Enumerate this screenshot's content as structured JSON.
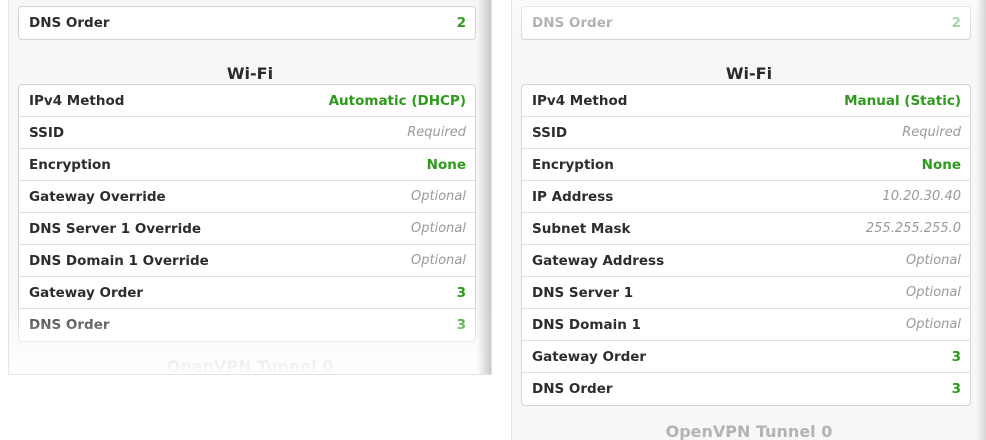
{
  "left": {
    "top_row": {
      "label": "DNS Order",
      "value": "2"
    },
    "section_title": "Wi-Fi",
    "rows": [
      {
        "label": "IPv4 Method",
        "value": "Automatic (DHCP)",
        "kind": "green"
      },
      {
        "label": "SSID",
        "value": "Required",
        "kind": "placeholder"
      },
      {
        "label": "Encryption",
        "value": "None",
        "kind": "green"
      },
      {
        "label": "Gateway Override",
        "value": "Optional",
        "kind": "placeholder"
      },
      {
        "label": "DNS Server 1 Override",
        "value": "Optional",
        "kind": "placeholder"
      },
      {
        "label": "DNS Domain 1 Override",
        "value": "Optional",
        "kind": "placeholder"
      },
      {
        "label": "Gateway Order",
        "value": "3",
        "kind": "green"
      },
      {
        "label": "DNS Order",
        "value": "3",
        "kind": "green"
      }
    ],
    "next_section": "OpenVPN Tunnel 0"
  },
  "right": {
    "top_row": {
      "label": "DNS Order",
      "value": "2"
    },
    "section_title": "Wi-Fi",
    "rows": [
      {
        "label": "IPv4 Method",
        "value": "Manual (Static)",
        "kind": "green"
      },
      {
        "label": "SSID",
        "value": "Required",
        "kind": "placeholder"
      },
      {
        "label": "Encryption",
        "value": "None",
        "kind": "green"
      },
      {
        "label": "IP Address",
        "value": "10.20.30.40",
        "kind": "placeholder"
      },
      {
        "label": "Subnet Mask",
        "value": "255.255.255.0",
        "kind": "placeholder"
      },
      {
        "label": "Gateway Address",
        "value": "Optional",
        "kind": "placeholder"
      },
      {
        "label": "DNS Server 1",
        "value": "Optional",
        "kind": "placeholder"
      },
      {
        "label": "DNS Domain 1",
        "value": "Optional",
        "kind": "placeholder"
      },
      {
        "label": "Gateway Order",
        "value": "3",
        "kind": "green"
      },
      {
        "label": "DNS Order",
        "value": "3",
        "kind": "green"
      }
    ],
    "next_section": "OpenVPN Tunnel 0"
  },
  "colors": {
    "value_green": "#2e9a1c",
    "placeholder_gray": "#9a9a9a",
    "subtitle_gray": "#b3b3b3"
  }
}
